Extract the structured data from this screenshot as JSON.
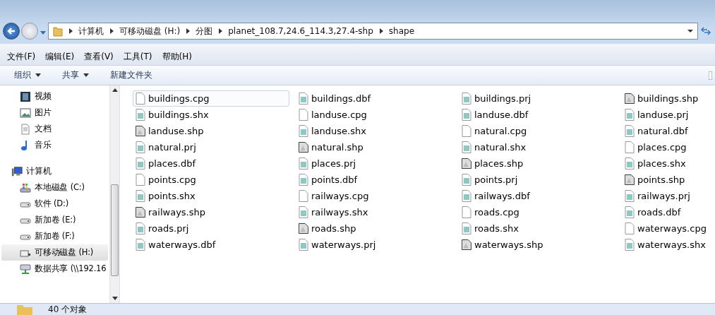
{
  "breadcrumb": [
    "计算机",
    "可移动磁盘 (H:)",
    "分图",
    "planet_108.7,24.6_114.3,27.4-shp",
    "shape"
  ],
  "menu": [
    "文件(F)",
    "编辑(E)",
    "查看(V)",
    "工具(T)",
    "帮助(H)"
  ],
  "toolbar": [
    {
      "label": "组织",
      "dropdown": true
    },
    {
      "label": "共享",
      "dropdown": true
    },
    {
      "label": "新建文件夹",
      "dropdown": false
    }
  ],
  "sidebar": {
    "items": [
      {
        "label": "视频",
        "kind": "video",
        "selected": false
      },
      {
        "label": "图片",
        "kind": "picture",
        "selected": false
      },
      {
        "label": "文档",
        "kind": "document",
        "selected": false
      },
      {
        "label": "音乐",
        "kind": "music",
        "selected": false
      },
      {
        "label": "计算机",
        "kind": "computer",
        "selected": false,
        "children": [
          {
            "label": "本地磁盘 (C:)",
            "kind": "system",
            "selected": false
          },
          {
            "label": "软件 (D:)",
            "kind": "drive",
            "selected": false
          },
          {
            "label": "新加卷 (E:)",
            "kind": "drive",
            "selected": false
          },
          {
            "label": "新加卷 (F:)",
            "kind": "drive",
            "selected": false
          },
          {
            "label": "可移动磁盘 (H:)",
            "kind": "removable",
            "selected": true
          },
          {
            "label": "数据共享 (\\\\192.16",
            "kind": "network",
            "selected": false
          }
        ]
      }
    ]
  },
  "files": [
    {
      "name": "buildings.cpg",
      "kind": "blank",
      "selected": true
    },
    {
      "name": "buildings.dbf",
      "kind": "data",
      "selected": false
    },
    {
      "name": "buildings.prj",
      "kind": "data",
      "selected": false
    },
    {
      "name": "buildings.shp",
      "kind": "shape",
      "selected": false
    },
    {
      "name": "buildings.shx",
      "kind": "data",
      "selected": false
    },
    {
      "name": "landuse.cpg",
      "kind": "blank",
      "selected": false
    },
    {
      "name": "landuse.dbf",
      "kind": "data",
      "selected": false
    },
    {
      "name": "landuse.prj",
      "kind": "data",
      "selected": false
    },
    {
      "name": "landuse.shp",
      "kind": "shape",
      "selected": false
    },
    {
      "name": "landuse.shx",
      "kind": "data",
      "selected": false
    },
    {
      "name": "natural.cpg",
      "kind": "blank",
      "selected": false
    },
    {
      "name": "natural.dbf",
      "kind": "data",
      "selected": false
    },
    {
      "name": "natural.prj",
      "kind": "data",
      "selected": false
    },
    {
      "name": "natural.shp",
      "kind": "shape",
      "selected": false
    },
    {
      "name": "natural.shx",
      "kind": "data",
      "selected": false
    },
    {
      "name": "places.cpg",
      "kind": "blank",
      "selected": false
    },
    {
      "name": "places.dbf",
      "kind": "data",
      "selected": false
    },
    {
      "name": "places.prj",
      "kind": "data",
      "selected": false
    },
    {
      "name": "places.shp",
      "kind": "shape",
      "selected": false
    },
    {
      "name": "places.shx",
      "kind": "data",
      "selected": false
    },
    {
      "name": "points.cpg",
      "kind": "blank",
      "selected": false
    },
    {
      "name": "points.dbf",
      "kind": "data",
      "selected": false
    },
    {
      "name": "points.prj",
      "kind": "data",
      "selected": false
    },
    {
      "name": "points.shp",
      "kind": "shape",
      "selected": false
    },
    {
      "name": "points.shx",
      "kind": "data",
      "selected": false
    },
    {
      "name": "railways.cpg",
      "kind": "blank",
      "selected": false
    },
    {
      "name": "railways.dbf",
      "kind": "data",
      "selected": false
    },
    {
      "name": "railways.prj",
      "kind": "data",
      "selected": false
    },
    {
      "name": "railways.shp",
      "kind": "shape",
      "selected": false
    },
    {
      "name": "railways.shx",
      "kind": "data",
      "selected": false
    },
    {
      "name": "roads.cpg",
      "kind": "blank",
      "selected": false
    },
    {
      "name": "roads.dbf",
      "kind": "data",
      "selected": false
    },
    {
      "name": "roads.prj",
      "kind": "data",
      "selected": false
    },
    {
      "name": "roads.shp",
      "kind": "shape",
      "selected": false
    },
    {
      "name": "roads.shx",
      "kind": "data",
      "selected": false
    },
    {
      "name": "waterways.cpg",
      "kind": "blank",
      "selected": false
    },
    {
      "name": "waterways.dbf",
      "kind": "data",
      "selected": false
    },
    {
      "name": "waterways.prj",
      "kind": "data",
      "selected": false
    },
    {
      "name": "waterways.shp",
      "kind": "shape",
      "selected": false
    },
    {
      "name": "waterways.shx",
      "kind": "data",
      "selected": false
    }
  ],
  "status_bar": {
    "count": "40 个对象"
  }
}
